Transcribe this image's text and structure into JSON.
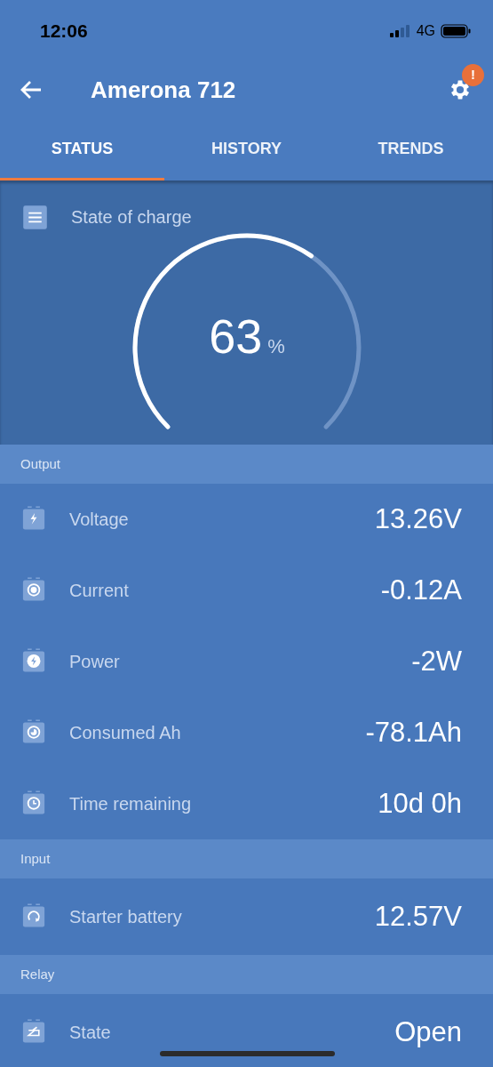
{
  "status_bar": {
    "time": "12:06",
    "network": "4G"
  },
  "header": {
    "title": "Amerona 712",
    "alert": "!"
  },
  "tabs": [
    {
      "label": "STATUS",
      "selected": true
    },
    {
      "label": "HISTORY",
      "selected": false
    },
    {
      "label": "TRENDS",
      "selected": false
    }
  ],
  "state_of_charge": {
    "label": "State of charge",
    "value": "63",
    "unit": "%"
  },
  "sections": [
    {
      "title": "Output",
      "rows": [
        {
          "kind": "voltage",
          "label": "Voltage",
          "value": "13.26V"
        },
        {
          "kind": "current",
          "label": "Current",
          "value": "-0.12A"
        },
        {
          "kind": "power",
          "label": "Power",
          "value": "-2W"
        },
        {
          "kind": "consumed",
          "label": "Consumed Ah",
          "value": "-78.1Ah"
        },
        {
          "kind": "time",
          "label": "Time remaining",
          "value": "10d 0h"
        }
      ]
    },
    {
      "title": "Input",
      "rows": [
        {
          "kind": "starter",
          "label": "Starter battery",
          "value": "12.57V"
        }
      ]
    },
    {
      "title": "Relay",
      "rows": [
        {
          "kind": "relay",
          "label": "State",
          "value": "Open"
        }
      ]
    }
  ]
}
